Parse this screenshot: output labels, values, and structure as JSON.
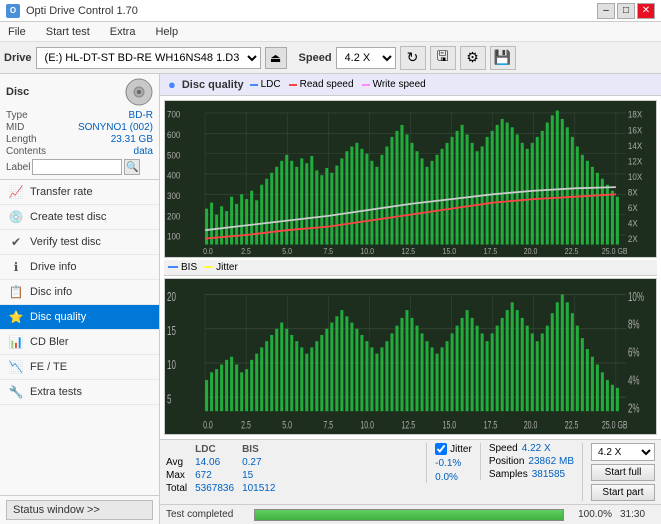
{
  "titleBar": {
    "title": "Opti Drive Control 1.70",
    "iconLabel": "O",
    "minBtn": "–",
    "maxBtn": "□",
    "closeBtn": "✕"
  },
  "menuBar": {
    "items": [
      "File",
      "Start test",
      "Extra",
      "Help"
    ]
  },
  "toolbar": {
    "driveLabel": "Drive",
    "driveValue": "(E:)  HL-DT-ST BD-RE  WH16NS48 1.D3",
    "speedLabel": "Speed",
    "speedValue": "4.2 X",
    "ejectIcon": "⏏"
  },
  "disc": {
    "title": "Disc",
    "typeLabel": "Type",
    "typeValue": "BD-R",
    "midLabel": "MID",
    "midValue": "SONYNO1 (002)",
    "lengthLabel": "Length",
    "lengthValue": "23.31 GB",
    "contentsLabel": "Contents",
    "contentsValue": "data",
    "labelLabel": "Label"
  },
  "navItems": [
    {
      "id": "transfer-rate",
      "label": "Transfer rate",
      "icon": "📈"
    },
    {
      "id": "create-test-disc",
      "label": "Create test disc",
      "icon": "💿"
    },
    {
      "id": "verify-test-disc",
      "label": "Verify test disc",
      "icon": "✔"
    },
    {
      "id": "drive-info",
      "label": "Drive info",
      "icon": "ℹ"
    },
    {
      "id": "disc-info",
      "label": "Disc info",
      "icon": "📋"
    },
    {
      "id": "disc-quality",
      "label": "Disc quality",
      "icon": "⭐",
      "active": true
    },
    {
      "id": "cd-bler",
      "label": "CD Bler",
      "icon": "📊"
    },
    {
      "id": "fe-te",
      "label": "FE / TE",
      "icon": "📉"
    },
    {
      "id": "extra-tests",
      "label": "Extra tests",
      "icon": "🔧"
    }
  ],
  "statusWindow": {
    "label": "Status window >>"
  },
  "qualityPanel": {
    "title": "Disc quality",
    "legend": [
      {
        "label": "LDC",
        "color": "#4488ff"
      },
      {
        "label": "Read speed",
        "color": "#ff4444"
      },
      {
        "label": "Write speed",
        "color": "#ff88ff"
      }
    ],
    "legend2": [
      {
        "label": "BIS",
        "color": "#4488ff"
      },
      {
        "label": "Jitter",
        "color": "#ffff44"
      }
    ]
  },
  "statsTable": {
    "headers": [
      "",
      "LDC",
      "BIS",
      "",
      "Jitter",
      "Speed",
      "",
      ""
    ],
    "rows": [
      {
        "label": "Avg",
        "ldc": "14.06",
        "bis": "0.27",
        "jitter": "-0.1%",
        "speedLabel": "Speed",
        "speedVal": "4.22 X"
      },
      {
        "label": "Max",
        "ldc": "672",
        "bis": "15",
        "jitter": "0.0%",
        "posLabel": "Position",
        "posVal": "23862 MB"
      },
      {
        "label": "Total",
        "ldc": "5367836",
        "bis": "101512",
        "jitter": "",
        "sampLabel": "Samples",
        "sampVal": "381585"
      }
    ],
    "jitterChecked": true,
    "speedSelectValue": "4.2 X",
    "startFullLabel": "Start full",
    "startPartLabel": "Start part"
  },
  "progressArea": {
    "statusText": "Test completed",
    "progressPercent": 100,
    "progressLabel": "100.0%",
    "timeLabel": "31:30"
  },
  "charts": {
    "top": {
      "yMax": 700,
      "yMin": 0,
      "xMax": 25,
      "yLabelsLeft": [
        "700",
        "600",
        "500",
        "400",
        "300",
        "200",
        "100"
      ],
      "yLabelsRight": [
        "18X",
        "16X",
        "14X",
        "12X",
        "10X",
        "8X",
        "6X",
        "4X",
        "2X"
      ],
      "xLabels": [
        "0.0",
        "2.5",
        "5.0",
        "7.5",
        "10.0",
        "12.5",
        "15.0",
        "17.5",
        "20.0",
        "22.5",
        "25.0 GB"
      ]
    },
    "bottom": {
      "yMax": 20,
      "yMin": 0,
      "xMax": 25,
      "yLabelsLeft": [
        "20",
        "15",
        "10",
        "5"
      ],
      "yLabelsRight": [
        "10%",
        "8%",
        "6%",
        "4%",
        "2%"
      ],
      "xLabels": [
        "0.0",
        "2.5",
        "5.0",
        "7.5",
        "10.0",
        "12.5",
        "15.0",
        "17.5",
        "20.0",
        "22.5",
        "25.0 GB"
      ]
    }
  }
}
